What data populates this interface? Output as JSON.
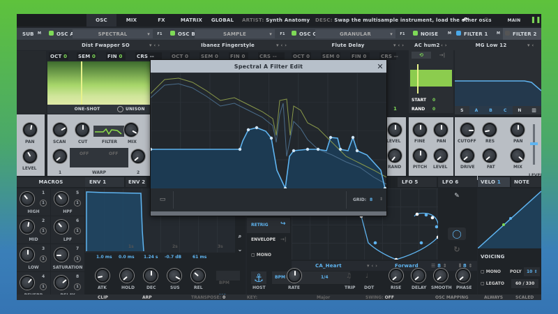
{
  "topbar": {
    "tabs": [
      "OSC",
      "MIX",
      "FX",
      "MATRIX",
      "GLOBAL"
    ],
    "artist_label": "ARTIST:",
    "artist": "Synth Anatomy",
    "desc_label": "DESC:",
    "desc": "Swap the multisample instrument, load the other oscs",
    "main_label": "MAIN"
  },
  "sub": {
    "label": "SUB",
    "mute": "M"
  },
  "osc_a": {
    "label": "OSC A",
    "type": "SPECTRAL",
    "fx": "F1",
    "preset": "Dist Fwapper SO",
    "oct": "0",
    "sem": "0",
    "fin": "0",
    "crs": "--",
    "mode": "ONE-SHOT",
    "unison": "UNISON"
  },
  "osc_b": {
    "label": "OSC B",
    "type": "SAMPLE",
    "fx": "F1",
    "preset": "Ibanez Fingerstyle",
    "oct": "0",
    "sem": "0",
    "fin": "0",
    "crs": "--"
  },
  "osc_c": {
    "label": "OSC C",
    "type": "GRANULAR",
    "fx": "F1",
    "preset": "Flute Delay",
    "oct": "0",
    "sem": "0",
    "fin": "0",
    "crs": "--",
    "voices": "1"
  },
  "field_labels": {
    "oct": "OCT",
    "sem": "SEM",
    "fin": "FIN",
    "crs": "CRS"
  },
  "noise": {
    "label": "NOISE",
    "mute": "M",
    "preset": "AC hum2",
    "start_label": "START",
    "start": "0",
    "rand_label": "RAND",
    "rand": "0"
  },
  "filter1": {
    "label": "FILTER 1",
    "mute": "M",
    "preset": "MG Low 12",
    "routes": [
      "S",
      "A",
      "B",
      "C",
      "N"
    ]
  },
  "filter2": {
    "label": "FILTER 2",
    "mute": "M"
  },
  "knobs": {
    "pan": "PAN",
    "level": "LEVEL",
    "scan": "SCAN",
    "cut": "CUT",
    "filter": "FILTER",
    "mix": "MIX",
    "warp": "WARP",
    "warp1": "1",
    "warp2": "2",
    "off": "OFF",
    "rand": "RAND",
    "fine": "FINE",
    "pitch": "PITCH",
    "cutoff": "CUTOFF",
    "res": "RES",
    "drive": "DRIVE",
    "fat": "FAT"
  },
  "popup": {
    "title": "Spectral A Filter Edit",
    "grid_label": "GRID:",
    "grid": "8"
  },
  "macros": {
    "title": "MACROS",
    "items": [
      {
        "label": "HIGH",
        "n": "1"
      },
      {
        "label": "HPF",
        "n": "5"
      },
      {
        "label": "MID",
        "n": "2"
      },
      {
        "label": "LPF",
        "n": "6"
      },
      {
        "label": "LOW",
        "n": "3"
      },
      {
        "label": "SATURATION",
        "n": "7"
      },
      {
        "label": "REVERB",
        "n": "4"
      },
      {
        "label": "DELAY",
        "n": "8"
      }
    ],
    "badge": "1"
  },
  "env": {
    "tabs": [
      "ENV 1",
      "ENV 2"
    ],
    "time_marks": [
      "1s",
      "2s",
      "3s"
    ],
    "values": [
      "1.0 ms",
      "0.0 ms",
      "1.24 s",
      "-0.7 dB",
      "61 ms"
    ],
    "knobs": [
      "ATK",
      "HOLD",
      "DEC",
      "SUS",
      "REL"
    ],
    "bpm": "BPM",
    "ms": "MS"
  },
  "lfo": {
    "tabs": [
      "LFO 5",
      "LFO 6"
    ],
    "retrig": "RETRIG",
    "envelope": "ENVELOPE",
    "mono": "MONO",
    "shape": "CA_Heart",
    "direction": "Forward",
    "grid_x": "8",
    "grid_y": "8",
    "host": "HOST",
    "bpm": "BPM",
    "hz": "HZ",
    "rate_value": "1/4",
    "knobs": [
      "RATE",
      "TRIP",
      "DOT",
      "RISE",
      "DELAY",
      "SMOOTH",
      "PHASE"
    ]
  },
  "velo": {
    "tabs": [
      "VELO",
      "NOTE"
    ],
    "badge": "1"
  },
  "voicing": {
    "title": "VOICING",
    "mono": "MONO",
    "poly_label": "POLY",
    "poly": "10",
    "legato": "LEGATO",
    "voices": "60 / 330"
  },
  "footer": {
    "clip": "CLIP",
    "arp": "ARP",
    "transpose_label": "TRANSPOSE:",
    "transpose": "0",
    "key_label": "KEY:",
    "scale": "Major",
    "swing_label": "SWING:",
    "swing": "OFF",
    "osc_mapping": "OSC MAPPING",
    "always": "ALWAYS",
    "scaled": "SCALED"
  },
  "colors": {
    "accent": "#5fb4f0",
    "osc_led": "#7ed957",
    "panel": "#22262b",
    "light_panel": "#b9bec4"
  }
}
